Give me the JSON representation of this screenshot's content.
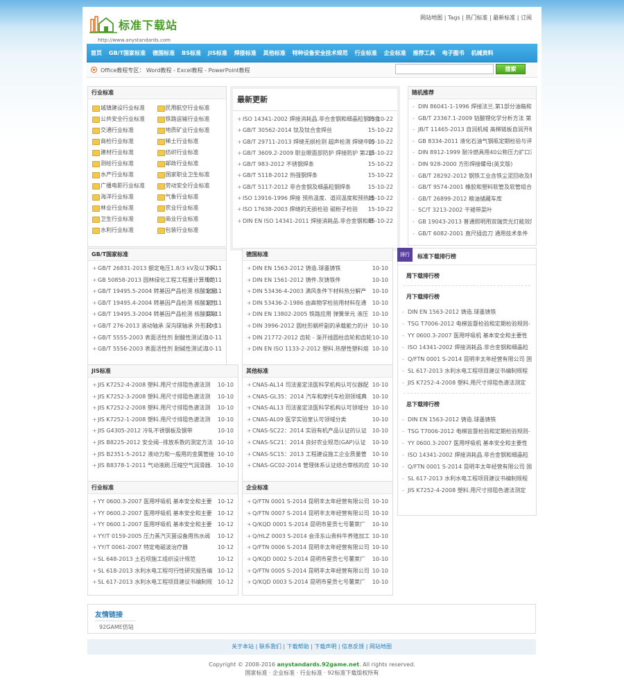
{
  "header": {
    "logo_text": "标准下载站",
    "logo_url": "http://www.anystandards.com",
    "top_links": "网站地图 | Tags | 热门标准 | 最新标准 | 订阅"
  },
  "nav": [
    "首页",
    "GB/T国家标准",
    "德国标准",
    "BS标准",
    "JIS标准",
    "焊接标准",
    "其他标准",
    "特种设备安全技术规范",
    "行业标准",
    "企业标准",
    "推荐工具",
    "电子图书",
    "机械资料"
  ],
  "subbar": {
    "text": "Office教程专区：  Word教程 - Excel教程 - PowerPoint教程",
    "search_placeholder": "",
    "search_button": "搜索"
  },
  "industry": {
    "title": "行业标准",
    "items": [
      "城镇建设行业标准",
      "民用航空行业标准",
      "公共安全行业标准",
      "铁路运输行业标准",
      "交通行业标准",
      "地质矿业行业标准",
      "商检行业标准",
      "稀土行业标准",
      "建材行业标准",
      "纺织行业标准",
      "测绘行业标准",
      "邮政行业标准",
      "水产行业标准",
      "国家职业卫生标准",
      "广播电影行业标准",
      "劳动安全行业标准",
      "海洋行业标准",
      "气象行业标准",
      "林业行业标准",
      "农业行业标准",
      "卫生行业标准",
      "商业行业标准",
      "水利行业标准",
      "包装行业标准"
    ]
  },
  "latest": {
    "title": "最新更新",
    "items": [
      {
        "t": "ISO 14341-2002 焊接消耗品.非合金钢和细晶粒钢的金",
        "d": "15-10-22"
      },
      {
        "t": "GB/T 30562-2014 钛及钛合金焊丝",
        "d": "15-10-22"
      },
      {
        "t": "GB/T 29711-2013 焊缝无损检测 超声检测 焊缝中的",
        "d": "15-10-22"
      },
      {
        "t": "GB/T 3609.2-2009 职业眼面部防护 焊接防护 第2部",
        "d": "15-10-22"
      },
      {
        "t": "GB/T 983-2012 不锈钢焊条",
        "d": "15-10-22"
      },
      {
        "t": "GB/T 5118-2012 热强钢焊条",
        "d": "15-10-22"
      },
      {
        "t": "GB/T 5117-2012 非合金钢及细晶粒钢焊条",
        "d": "15-10-22"
      },
      {
        "t": "ISO 13916-1996 焊接 预热温度、道间温度和预热维",
        "d": "15-10-22"
      },
      {
        "t": "ISO 17638-2003 焊缝的无损检验 磁粉子检验",
        "d": "15-10-22"
      },
      {
        "t": "DIN EN ISO 14341-2011 焊接消耗品.非合金钢和细",
        "d": "15-10-22"
      }
    ]
  },
  "random": {
    "title": "随机推荐",
    "items": [
      "DIN 86041-1-1996 焊接法兰.第1部分油箱和",
      "GB/T 23367.1-2009 钴酸锂化学分析方法 第1",
      "JB/T 11465-2013 自润机械 高梯链板自润开槽",
      "GB 8334-2011 液化石油气钢瓶定期检验与评",
      "DIN 8912-1999 耐冷燃具用40公称压力扩口法",
      "DIN 928-2000 方形焊接螺母(英文版)",
      "GB/T 28292-2012 钢铁工业含铁尘泥回收及利",
      "GB/T 9574-2001 橡胶和塑料软管及软管组合",
      "GB/T 26899-2012 粮油储藏车库",
      "SC/T 3213-2002 干裙带菜叶",
      "GB 19043-2013 普通照明用双端荧光灯能效限",
      "GB/T 6082-2001 直尺插齿刀 通用技术条件"
    ]
  },
  "gb": {
    "title": "GB/T国家标准",
    "items": [
      {
        "t": "GB/T 26831-2013 额定电压1.8/3 kV及以下风",
        "d": "10-11"
      },
      {
        "t": "GB 50858-2013 园林绿化工程工程量计算规范",
        "d": "10-11"
      },
      {
        "t": "GB/T 19495.5-2004 转基因产品检测 核酸定量",
        "d": "10-11"
      },
      {
        "t": "GB/T 19495.4-2004 转基因产品检测 核酸定性",
        "d": "10-11"
      },
      {
        "t": "GB/T 19495.3-2004 转基因产品检测 核酸提取",
        "d": "10-11"
      },
      {
        "t": "GB/T 276-2013 滚动轴承 深沟球轴承 外形尺寸",
        "d": "10-11"
      },
      {
        "t": "GB/T 5555-2003 表面活性剂 耐酸性测试法",
        "d": "10-11"
      },
      {
        "t": "GB/T 5556-2003 表面活性剂 耐碱性测试法",
        "d": "10-11"
      }
    ]
  },
  "de": {
    "title": "德国标准",
    "items": [
      {
        "t": "DIN EN 1563-2012 铸造.球墨铸铁",
        "d": "10-10"
      },
      {
        "t": "DIN EN 1561-2012 铸件.灰铸铁件",
        "d": "10-10"
      },
      {
        "t": "DIN 53436-4-2003 满风条件下材料热分解产",
        "d": "10-10"
      },
      {
        "t": "DIN 53436-2-1986 由高物学检验用材料在通",
        "d": "10-10"
      },
      {
        "t": "DIN EN 13802-2005 铁路应用 弹簧单元 液压",
        "d": "10-10"
      },
      {
        "t": "DIN 3996-2012 圆柱形蜗杆副的承载能力的计",
        "d": "10-10"
      },
      {
        "t": "DIN 21772-2012 齿轮 - 渐开线圆柱齿轮和齿轮",
        "d": "10-10"
      },
      {
        "t": "DIN EN ISO 1133-2-2012 塑料.热塑性塑料熔",
        "d": "10-10"
      }
    ]
  },
  "jis": {
    "title": "JIS标准",
    "items": [
      {
        "t": "JIS K7252-4-2008 塑料.用尺寸排阻色谱法测",
        "d": "10-10"
      },
      {
        "t": "JIS K7252-3-2008 塑料.用尺寸排阻色谱法测",
        "d": "10-10"
      },
      {
        "t": "JIS K7252-2-2008 塑料.用尺寸排阻色谱法测",
        "d": "10-10"
      },
      {
        "t": "JIS K7252-1-2008 塑料.用尺寸排阻色谱法测",
        "d": "10-10"
      },
      {
        "t": "JIS G4305-2012 冷轧不锈钢板及钢带",
        "d": "10-10"
      },
      {
        "t": "JIS B8225-2012 安全阀--排放系数的测定方法",
        "d": "10-10"
      },
      {
        "t": "JIS B2351-5-2012 液动力和一般用的金属管接",
        "d": "10-10"
      },
      {
        "t": "JIS B8378-1-2011 气动液刷.压缩空气润滑器.",
        "d": "10-10"
      }
    ]
  },
  "other": {
    "title": "其他标准",
    "items": [
      {
        "t": "CNAS-AL14 司法鉴定法医科学机构认可仪器配",
        "d": "10-10"
      },
      {
        "t": "CNAS-GL35：2014 汽车和摩托车检测领域典",
        "d": "10-10"
      },
      {
        "t": "CNAS-AL13 司法鉴定法医科学机构认可领域分",
        "d": "10-10"
      },
      {
        "t": "CNAS-AL09 医学实验室认可领域分类",
        "d": "10-10"
      },
      {
        "t": "CNAS-SC22：2014 实验有机产品认证的认证",
        "d": "10-10"
      },
      {
        "t": "CNAS-SC21：2014 良好农业规范(GAP)认证",
        "d": "10-10"
      },
      {
        "t": "CNAS-SC15：2013 工程建设施工企业质量管",
        "d": "10-10"
      },
      {
        "t": "CNAS-GC02-2014 管理体系认证结合审核的应",
        "d": "10-10"
      }
    ]
  },
  "hy": {
    "title": "行业标准",
    "items": [
      {
        "t": "YY 0600.3-2007 医用呼吸机 基本安全和主要",
        "d": "10-12"
      },
      {
        "t": "YY 0600.2-2007 医用呼吸机 基本安全和主要",
        "d": "10-12"
      },
      {
        "t": "YY 0600.1-2007 医用呼吸机 基本安全和主要",
        "d": "10-12"
      },
      {
        "t": "YY/T 0159-2005 压力蒸汽灭菌设备用热水阀",
        "d": "10-12"
      },
      {
        "t": "YY/T 0061-2007 特定电磁波治疗器",
        "d": "10-12"
      },
      {
        "t": "SL 648-2013 土石坝施工组织设计规范",
        "d": "10-12"
      },
      {
        "t": "SL 618-2013 水利水电工程可行性研究报告编",
        "d": "10-12"
      },
      {
        "t": "SL 617-2013 水利水电工程项目建议书编制规",
        "d": "10-12"
      }
    ]
  },
  "qy": {
    "title": "企业标准",
    "items": [
      {
        "t": "Q/FTN 0001 S-2014 昆明丰太年经营有限公司",
        "d": "10-10"
      },
      {
        "t": "Q/FTN 0007 S-2014 昆明丰太年经营有限公司",
        "d": "10-10"
      },
      {
        "t": "Q/KQD 0001 S-2014 昆明市星贡七号薯萊厂",
        "d": "10-10"
      },
      {
        "t": "Q/HLZ 0003 S-2014 会泽东山贵料牛养殖加工",
        "d": "10-10"
      },
      {
        "t": "Q/FTN 0006 S-2014 昆明丰太年经营有限公司",
        "d": "10-10"
      },
      {
        "t": "Q/KQD 0002 S-2014 昆明市星贡七号薯萊厂",
        "d": "10-10"
      },
      {
        "t": "Q/FTN 0005 S-2014 昆明丰太年经营有限公司",
        "d": "10-10"
      },
      {
        "t": "Q/KQD 0003 S-2014 昆明市星贡七号薯萊厂",
        "d": "10-10"
      }
    ]
  },
  "rank": {
    "tag": "排行",
    "title": "标准下载排行榜",
    "week_title": "周下载排行榜",
    "month_title": "月下载排行榜",
    "month": [
      "DIN EN 1563-2012 铸造.球墨铸铁",
      "TSG T7006-2012 电梯监督检验和定期检验规则-",
      "YY 0600.3-2007 医用呼吸机 基本安全和主要性",
      "ISO 14341-2002 焊接消耗品.非合金钢和细晶粒",
      "Q/FTN 0001 S-2014 昆明丰太年经营有限公司 国",
      "SL 617-2013 水利水电工程项目建议书编制规程",
      "JIS K7252-4-2008 塑料.用尺寸排阻色谱法测定"
    ],
    "total_title": "总下载排行榜",
    "total": [
      "DIN EN 1563-2012 铸造.球墨铸铁",
      "TSG T7006-2012 电梯监督检验和定期检验规则-",
      "YY 0600.3-2007 医用呼吸机 基本安全和主要性",
      "ISO 14341-2002 焊接消耗品.非合金钢和细晶粒",
      "Q/FTN 0001 S-2014 昆明丰太年经营有限公司 国",
      "SL 617-2013 水利水电工程项目建议书编制规程",
      "JIS K7252-4-2008 塑料.用尺寸排阻色谱法测定"
    ]
  },
  "friend": {
    "title": "友情链接",
    "link": "92GAME仿站"
  },
  "footer": {
    "nav": "关于本站 | 联系我们 | 下载帮助 | 下载声明 | 信息反馈 | 网站地图",
    "copy_prefix": "Copyright © 2008-2016 ",
    "copy_site": "anystandards.92game.net",
    "copy_suffix": ". All rights reserved.",
    "line2": "国家标准 · 企业标准 · 行业标准 · 92标准下载版权所有"
  }
}
